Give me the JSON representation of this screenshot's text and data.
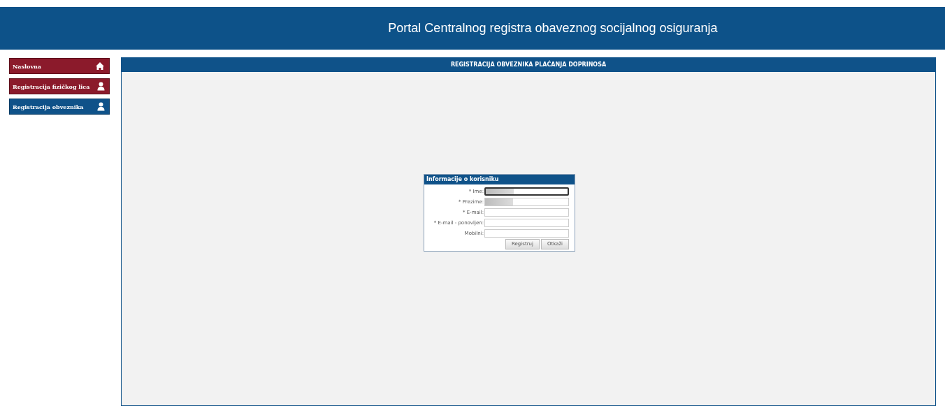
{
  "header": {
    "title": "Portal Centralnog registra obaveznog socijalnog osiguranja"
  },
  "sidebar": {
    "items": [
      {
        "label": "Naslovna",
        "kind": "home",
        "selected": false
      },
      {
        "label": "Registracija fizičkog lica",
        "kind": "user",
        "selected": false
      },
      {
        "label": "Registracija obveznika",
        "kind": "user",
        "selected": true
      }
    ]
  },
  "panel": {
    "title": "REGISTRACIJA OBVEZNIKA PLAĆANJA DOPRINOSA",
    "form": {
      "title": "Informacije o korisniku",
      "fields": [
        {
          "label": "* Ime:",
          "redacted": true,
          "focused": true
        },
        {
          "label": "* Prezime:",
          "redacted": true,
          "focused": false
        },
        {
          "label": "* E-mail:",
          "redacted": false,
          "focused": false
        },
        {
          "label": "* E-mail - ponovljen:",
          "redacted": false,
          "focused": false
        },
        {
          "label": "Mobilni:",
          "redacted": false,
          "focused": false
        }
      ],
      "buttons": [
        "Registruj",
        "Otkaži"
      ]
    }
  }
}
